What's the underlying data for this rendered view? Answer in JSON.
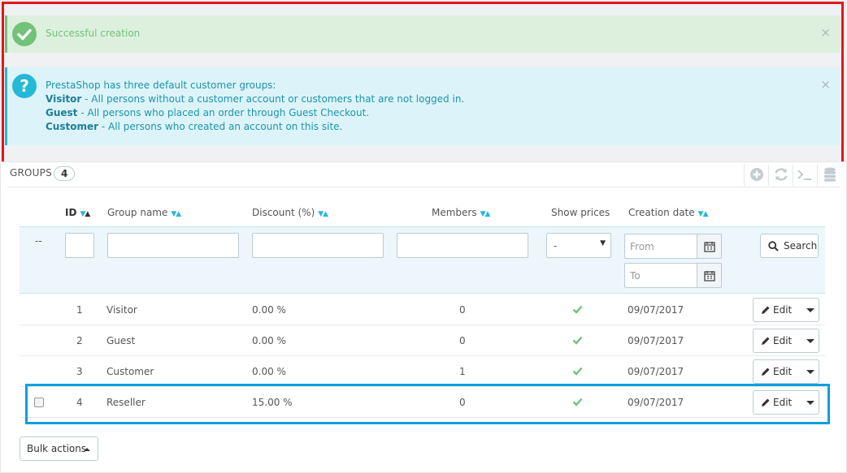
{
  "alerts": {
    "success": {
      "message": "Successful creation",
      "close": "×"
    },
    "info": {
      "intro": "PrestaShop has three default customer groups:",
      "lines": [
        {
          "term": "Visitor",
          "desc": " - All persons without a customer account or customers that are not logged in."
        },
        {
          "term": "Guest",
          "desc": " - All persons who placed an order through Guest Checkout."
        },
        {
          "term": "Customer",
          "desc": " - All persons who created an account on this site."
        }
      ],
      "close": "×"
    }
  },
  "panel": {
    "title": "GROUPS",
    "count": "4",
    "toolbar_icons": [
      "add-icon",
      "refresh-icon",
      "sql-query-icon",
      "export-database-icon"
    ]
  },
  "table": {
    "columns": {
      "id": "ID",
      "group_name": "Group name",
      "discount": "Discount (%)",
      "members": "Members",
      "show_prices": "Show prices",
      "creation_date": "Creation date"
    },
    "filters": {
      "select_all": "--",
      "show_prices_value": "-",
      "date_from_placeholder": "From",
      "date_to_placeholder": "To",
      "search_label": "Search"
    },
    "rows": [
      {
        "id": "1",
        "name": "Visitor",
        "discount": "0.00 %",
        "members": "0",
        "show_prices": true,
        "date": "09/07/2017",
        "edit": "Edit"
      },
      {
        "id": "2",
        "name": "Guest",
        "discount": "0.00 %",
        "members": "0",
        "show_prices": true,
        "date": "09/07/2017",
        "edit": "Edit"
      },
      {
        "id": "3",
        "name": "Customer",
        "discount": "0.00 %",
        "members": "1",
        "show_prices": true,
        "date": "09/07/2017",
        "edit": "Edit"
      },
      {
        "id": "4",
        "name": "Reseller",
        "discount": "15.00 %",
        "members": "0",
        "show_prices": true,
        "date": "09/07/2017",
        "edit": "Edit"
      }
    ]
  },
  "bulk_actions_label": "Bulk actions",
  "colors": {
    "success": "#72c279",
    "info": "#25b9d7",
    "highlight_red": "#e3151d",
    "highlight_blue": "#109edf"
  }
}
